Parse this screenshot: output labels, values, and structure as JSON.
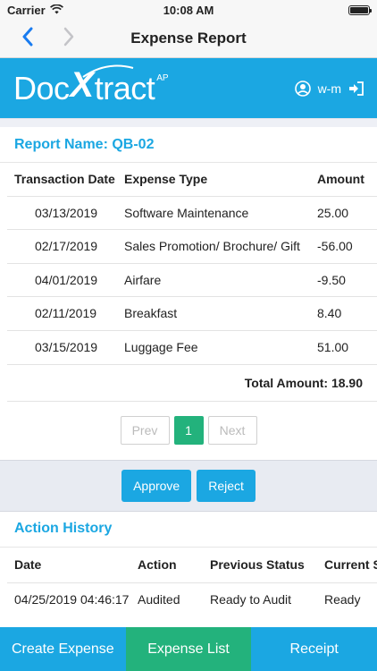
{
  "status_bar": {
    "carrier": "Carrier",
    "time": "10:08 AM"
  },
  "nav": {
    "title": "Expense Report",
    "back_icon": "chevron-left-icon",
    "forward_icon": "chevron-right-icon"
  },
  "brand": {
    "logo_main_1": "Doc",
    "logo_x": "X",
    "logo_main_2": "tract",
    "logo_super": "AP",
    "user": "w-m",
    "accent": "#1ba7e2"
  },
  "report": {
    "name_label": "Report Name: QB-02",
    "columns": [
      "Transaction Date",
      "Expense Type",
      "Amount"
    ],
    "rows": [
      {
        "date": "03/13/2019",
        "type": "Software Maintenance",
        "amount": "25.00"
      },
      {
        "date": "02/17/2019",
        "type": "Sales Promotion/ Brochure/ Gift",
        "amount": "-56.00"
      },
      {
        "date": "04/01/2019",
        "type": "Airfare",
        "amount": "-9.50"
      },
      {
        "date": "02/11/2019",
        "type": "Breakfast",
        "amount": "8.40"
      },
      {
        "date": "03/15/2019",
        "type": "Luggage Fee",
        "amount": "51.00"
      }
    ],
    "total_label": "Total Amount: 18.90"
  },
  "pagination": {
    "prev": "Prev",
    "current": "1",
    "next": "Next"
  },
  "actions": {
    "approve": "Approve",
    "reject": "Reject"
  },
  "history": {
    "title": "Action History",
    "columns": [
      "Date",
      "Action",
      "Previous Status",
      "Current Status"
    ],
    "rows": [
      {
        "date": "04/25/2019 04:46:17",
        "action": "Audited",
        "previous": "Ready to Audit",
        "current": "Ready"
      }
    ]
  },
  "tabs": [
    {
      "label": "Create Expense",
      "active": false
    },
    {
      "label": "Expense List",
      "active": true
    },
    {
      "label": "Receipt",
      "active": false
    }
  ],
  "colors": {
    "primary": "#1ba7e2",
    "success": "#23b27c"
  }
}
